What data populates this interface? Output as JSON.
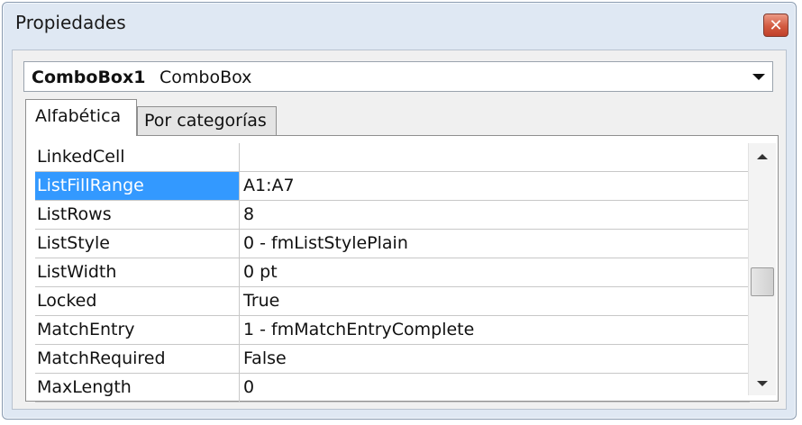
{
  "window": {
    "title": "Propiedades",
    "close_icon": "close-icon",
    "close_glyph": "✕"
  },
  "object_selector": {
    "name": "ComboBox1",
    "type": "ComboBox",
    "dropdown_icon": "chevron-down-icon"
  },
  "tabs": [
    {
      "label": "Alfabética",
      "active": true
    },
    {
      "label": "Por categorías",
      "active": false
    }
  ],
  "properties": [
    {
      "name": "LinkedCell",
      "value": ""
    },
    {
      "name": "ListFillRange",
      "value": "A1:A7",
      "selected": true
    },
    {
      "name": "ListRows",
      "value": "8"
    },
    {
      "name": "ListStyle",
      "value": "0 - fmListStylePlain"
    },
    {
      "name": "ListWidth",
      "value": "0 pt"
    },
    {
      "name": "Locked",
      "value": "True"
    },
    {
      "name": "MatchEntry",
      "value": "1 - fmMatchEntryComplete"
    },
    {
      "name": "MatchRequired",
      "value": "False"
    },
    {
      "name": "MaxLength",
      "value": "0"
    }
  ],
  "colors": {
    "selection": "#3399ff",
    "window_frame": "#dfe8f3",
    "close_button": "#d25a40"
  }
}
